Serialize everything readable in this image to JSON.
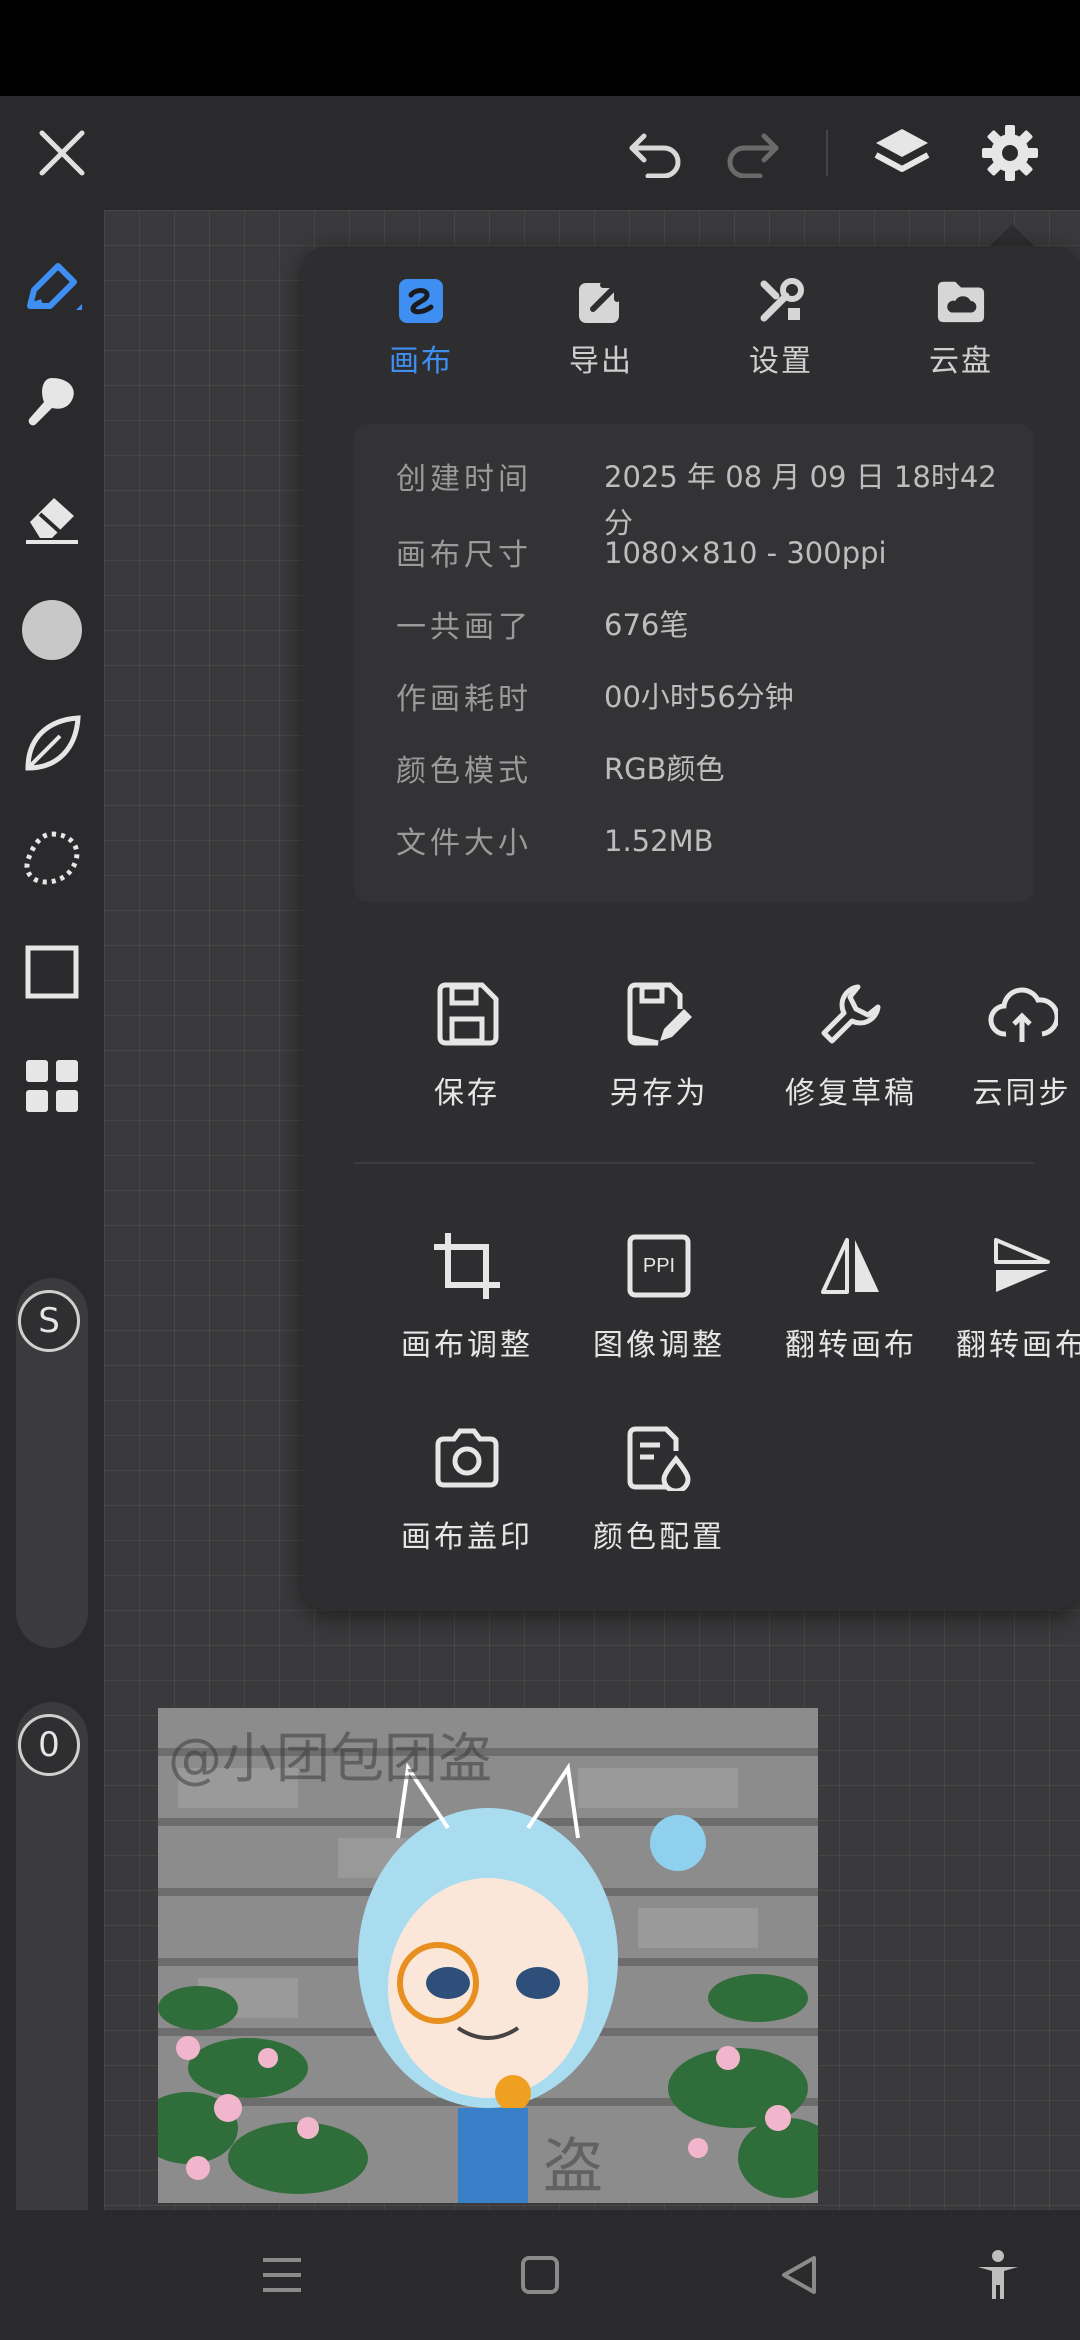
{
  "topbar": {
    "close_icon": "close-icon",
    "undo_icon": "undo-icon",
    "redo_icon": "redo-icon",
    "layers_icon": "layers-icon",
    "settings_icon": "gear-icon"
  },
  "tools": [
    {
      "name": "brush-tool",
      "icon": "pen-icon",
      "active": true
    },
    {
      "name": "smudge-tool",
      "icon": "smudge-icon"
    },
    {
      "name": "eraser-tool",
      "icon": "eraser-icon"
    },
    {
      "name": "color-tool",
      "icon": "color-circle-icon"
    },
    {
      "name": "leaf-tool",
      "icon": "leaf-icon"
    },
    {
      "name": "lasso-tool",
      "icon": "lasso-icon"
    },
    {
      "name": "shape-tool",
      "icon": "square-icon"
    },
    {
      "name": "more-tool",
      "icon": "grid-icon"
    }
  ],
  "sliders": {
    "size_label": "S",
    "opacity_label": "0"
  },
  "panel": {
    "tabs": [
      {
        "label": "画布",
        "icon": "canvas-icon",
        "active": true
      },
      {
        "label": "导出",
        "icon": "export-icon"
      },
      {
        "label": "设置",
        "icon": "tools-icon"
      },
      {
        "label": "云盘",
        "icon": "cloud-folder-icon"
      }
    ],
    "info": [
      {
        "key": "创建时间",
        "value": "2025 年 08 月 09 日  18时42分"
      },
      {
        "key": "画布尺寸",
        "value": "1080×810 - 300ppi"
      },
      {
        "key": "一共画了",
        "value": "676笔"
      },
      {
        "key": "作画耗时",
        "value": "00小时56分钟"
      },
      {
        "key": "颜色模式",
        "value": "RGB颜色"
      },
      {
        "key": "文件大小",
        "value": "1.52MB"
      }
    ],
    "actions_row1": [
      {
        "label": "保存",
        "icon": "save-icon"
      },
      {
        "label": "另存为",
        "icon": "save-as-icon"
      },
      {
        "label": "修复草稿",
        "icon": "wrench-icon"
      },
      {
        "label": "云同步",
        "icon": "cloud-sync-icon"
      }
    ],
    "actions_row2": [
      {
        "label": "画布调整",
        "icon": "crop-icon"
      },
      {
        "label": "图像调整",
        "icon": "ppi-icon",
        "icon_text": "PPI"
      },
      {
        "label": "翻转画布",
        "icon": "flip-horizontal-icon"
      },
      {
        "label": "翻转画布",
        "icon": "flip-vertical-icon"
      }
    ],
    "actions_row3": [
      {
        "label": "画布盖印",
        "icon": "camera-icon"
      },
      {
        "label": "颜色配置",
        "icon": "color-profile-icon"
      }
    ]
  },
  "artwork": {
    "watermark_top": "@小团包团盗",
    "watermark_bottom": "盗"
  },
  "colors": {
    "accent": "#3f8ff2",
    "panel_bg": "#2e2e30",
    "toolbar_bg": "#2a2a2c"
  }
}
